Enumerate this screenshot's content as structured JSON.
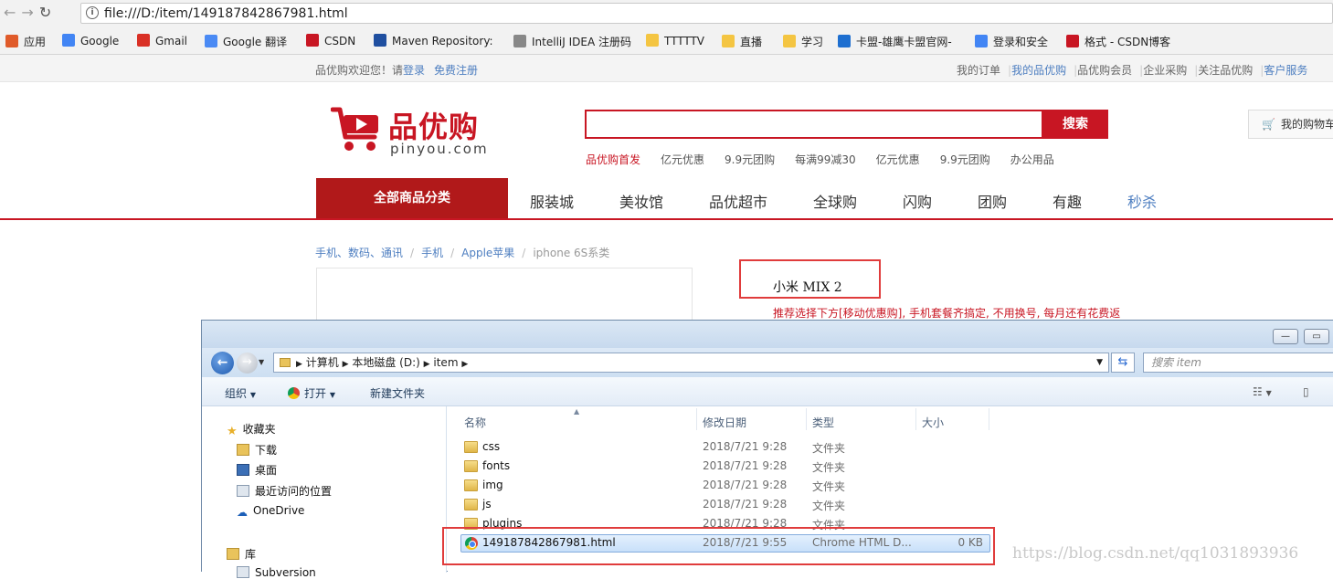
{
  "browser": {
    "url": "file:///D:/item/149187842867981.html",
    "bookmarks": [
      {
        "label": "应用",
        "icon": "apps-grid-icon",
        "color": "#e05b2a"
      },
      {
        "label": "Google",
        "icon": "google-icon",
        "color": "#4285f4"
      },
      {
        "label": "Gmail",
        "icon": "gmail-icon",
        "color": "#d93025"
      },
      {
        "label": "Google 翻译",
        "icon": "translate-icon",
        "color": "#4a8af4"
      },
      {
        "label": "CSDN",
        "icon": "csdn-icon",
        "color": "#c81623"
      },
      {
        "label": "Maven Repository:",
        "icon": "maven-icon",
        "color": "#1f4fa0"
      },
      {
        "label": "IntelliJ IDEA 注册码",
        "icon": "page-icon",
        "color": "#888888"
      },
      {
        "label": "TTTTTV",
        "icon": "folder-icon",
        "color": "#f4c542"
      },
      {
        "label": "直播",
        "icon": "folder-icon",
        "color": "#f4c542"
      },
      {
        "label": "学习",
        "icon": "folder-icon",
        "color": "#f4c542"
      },
      {
        "label": "卡盟-雄鹰卡盟官网-",
        "icon": "kameng-icon",
        "color": "#1e6fd0"
      },
      {
        "label": "登录和安全",
        "icon": "google-icon",
        "color": "#4285f4"
      },
      {
        "label": "格式 - CSDN博客",
        "icon": "csdn-icon",
        "color": "#c81623"
      }
    ]
  },
  "site": {
    "welcome_prefix": "品优购欢迎您！请",
    "login": "登录",
    "register": "免费注册",
    "top_links": [
      "我的订单",
      "我的品优购",
      "品优购会员",
      "企业采购",
      "关注品优购",
      "客户服务"
    ],
    "logo_text": "品优购",
    "logo_domain": "pinyou.com",
    "search_button": "搜索",
    "hot_words": [
      "品优购首发",
      "亿元优惠",
      "9.9元团购",
      "每满99减30",
      "亿元优惠",
      "9.9元团购",
      "办公用品"
    ],
    "cart_label": "我的购物车",
    "all_categories": "全部商品分类",
    "nav": [
      "服装城",
      "美妆馆",
      "品优超市",
      "全球购",
      "闪购",
      "团购",
      "有趣",
      "秒杀"
    ],
    "breadcrumb": [
      "手机、数码、通讯",
      "手机",
      "Apple苹果",
      "iphone 6S系类"
    ],
    "product_title": "小米 MIX 2",
    "promo_text": "推荐选择下方[移动优惠购], 手机套餐齐搞定, 不用换号, 每月还有花费返",
    "accent_color": "#c81623"
  },
  "explorer": {
    "path": [
      "计算机",
      "本地磁盘 (D:)",
      "item"
    ],
    "search_placeholder": "搜索 item",
    "toolbar": {
      "organize": "组织",
      "open": "打开",
      "new_folder": "新建文件夹"
    },
    "nav_items": [
      "收藏夹",
      "下载",
      "桌面",
      "最近访问的位置",
      "OneDrive",
      "库",
      "Subversion"
    ],
    "columns": [
      "名称",
      "修改日期",
      "类型",
      "大小"
    ],
    "files": [
      {
        "name": "css",
        "date": "2018/7/21 9:28",
        "type": "文件夹",
        "size": ""
      },
      {
        "name": "fonts",
        "date": "2018/7/21 9:28",
        "type": "文件夹",
        "size": ""
      },
      {
        "name": "img",
        "date": "2018/7/21 9:28",
        "type": "文件夹",
        "size": ""
      },
      {
        "name": "js",
        "date": "2018/7/21 9:28",
        "type": "文件夹",
        "size": ""
      },
      {
        "name": "plugins",
        "date": "2018/7/21 9:28",
        "type": "文件夹",
        "size": ""
      },
      {
        "name": "149187842867981.html",
        "date": "2018/7/21 9:55",
        "type": "Chrome HTML D...",
        "size": "0 KB"
      }
    ]
  },
  "watermark": "https://blog.csdn.net/qq1031893936"
}
